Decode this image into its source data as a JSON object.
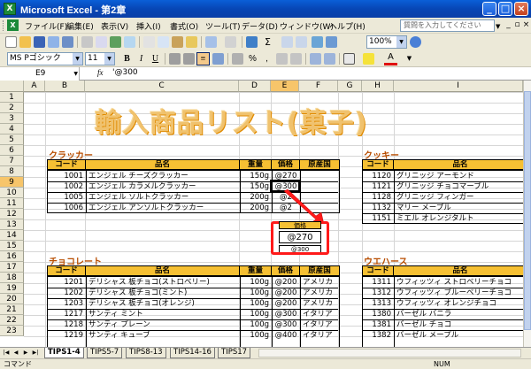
{
  "window": {
    "title": "Microsoft Excel - 第2章"
  },
  "menu": {
    "items": [
      "ファイル(F)",
      "編集(E)",
      "表示(V)",
      "挿入(I)",
      "書式(O)",
      "ツール(T)",
      "データ(D)",
      "ウィンドウ(W)",
      "ヘルプ(H)"
    ],
    "help_placeholder": "質問を入力してください"
  },
  "toolbar": {
    "zoom": "100%",
    "font_name": "MS Pゴシック",
    "font_size": "11",
    "bold": "B",
    "italic": "I",
    "underline": "U",
    "percent": "%",
    "comma": ",",
    "sigma": "Σ",
    "font_color_letter": "A"
  },
  "formula_bar": {
    "name_box": "E9",
    "fx": "fx",
    "formula": "'@300"
  },
  "columns": [
    "A",
    "B",
    "C",
    "D",
    "E",
    "F",
    "G",
    "H",
    "I"
  ],
  "rows": [
    "1",
    "2",
    "3",
    "4",
    "5",
    "6",
    "7",
    "8",
    "9",
    "10",
    "11",
    "12",
    "13",
    "14",
    "15",
    "16",
    "17",
    "18",
    "19",
    "20",
    "21",
    "22",
    "23"
  ],
  "sheet_title": "輸入商品リスト(菓子)",
  "tables": {
    "crackers": {
      "title": "クラッカー",
      "headers": [
        "コード",
        "品名",
        "重量",
        "価格",
        "原産国"
      ],
      "rows": [
        [
          "1001",
          "エンジェル チーズクラッカー",
          "150g",
          "@270",
          ""
        ],
        [
          "1002",
          "エンジェル カラメルクラッカー",
          "150g",
          "@300",
          ""
        ],
        [
          "1005",
          "エンジェル ソルトクラッカー",
          "200g",
          "@2",
          ""
        ],
        [
          "1006",
          "エンジェル アンソルトクラッカー",
          "200g",
          "@2",
          ""
        ]
      ]
    },
    "cookies": {
      "title": "クッキー",
      "headers": [
        "コード",
        "品名"
      ],
      "rows": [
        [
          "1120",
          "グリニッジ アーモンド"
        ],
        [
          "1121",
          "グリニッジ チョコマーブル"
        ],
        [
          "1128",
          "グリニッジ フィンガー"
        ],
        [
          "1132",
          "マリー メープル"
        ],
        [
          "1151",
          "ミエル オレンジタルト"
        ]
      ]
    },
    "chocolate": {
      "title": "チョコレート",
      "headers": [
        "コード",
        "品名",
        "重量",
        "価格",
        "原産国"
      ],
      "rows": [
        [
          "1201",
          "デリシャス 板チョコ(ストロベリー)",
          "100g",
          "@200",
          "アメリカ"
        ],
        [
          "1202",
          "デリシャス 板チョコ(ミント)",
          "100g",
          "@200",
          "アメリカ"
        ],
        [
          "1203",
          "デリシャス 板チョコ(オレンジ)",
          "100g",
          "@200",
          "アメリカ"
        ],
        [
          "1217",
          "サンティ ミント",
          "100g",
          "@300",
          "イタリア"
        ],
        [
          "1218",
          "サンティ プレーン",
          "100g",
          "@300",
          "イタリア"
        ],
        [
          "1219",
          "サンティ キューブ",
          "100g",
          "@400",
          "イタリア"
        ]
      ]
    },
    "wafers": {
      "title": "ウエハース",
      "headers": [
        "コード",
        "品名"
      ],
      "rows": [
        [
          "1311",
          "ウフィッツィ ストロベリーチョコ"
        ],
        [
          "1312",
          "ウフィッツィ ブルーベリーチョコ"
        ],
        [
          "1313",
          "ウフィッツィ オレンジチョコ"
        ],
        [
          "1380",
          "バーゼル バニラ"
        ],
        [
          "1381",
          "バーゼル チョコ"
        ],
        [
          "1382",
          "バーゼル メープル"
        ]
      ]
    }
  },
  "callout": {
    "value": "@270",
    "top_fragment": "価格",
    "bottom_fragment": "@300"
  },
  "sheet_tabs": [
    "TIPS1-4",
    "TIPS5-7",
    "TIPS8-13",
    "TIPS14-16",
    "TIPS17"
  ],
  "status": {
    "mode": "コマンド",
    "num": "NUM"
  },
  "colors": {
    "header_fill": "#f6c033",
    "section_title": "#b84d00",
    "title_fill": "#f0c26e",
    "callout_border": "#ff1a1a"
  }
}
